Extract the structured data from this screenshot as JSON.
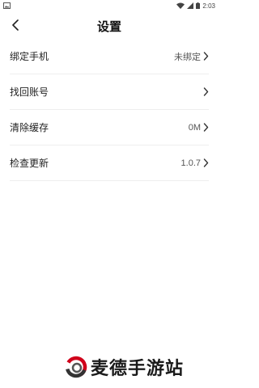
{
  "status_bar": {
    "time": "2:03",
    "icons": [
      "image-icon",
      "wifi-icon",
      "signal-icon",
      "battery-icon"
    ]
  },
  "header": {
    "title": "设置",
    "back_icon": "chevron-left-icon"
  },
  "settings": [
    {
      "label": "绑定手机",
      "value": "未绑定"
    },
    {
      "label": "找回账号",
      "value": ""
    },
    {
      "label": "清除缓存",
      "value": "0M"
    },
    {
      "label": "检查更新",
      "value": "1.0.7"
    }
  ],
  "watermark": {
    "text": "麦德手游站",
    "colors": {
      "ring_red": "#d0021b",
      "ring_dark": "#333333"
    }
  }
}
